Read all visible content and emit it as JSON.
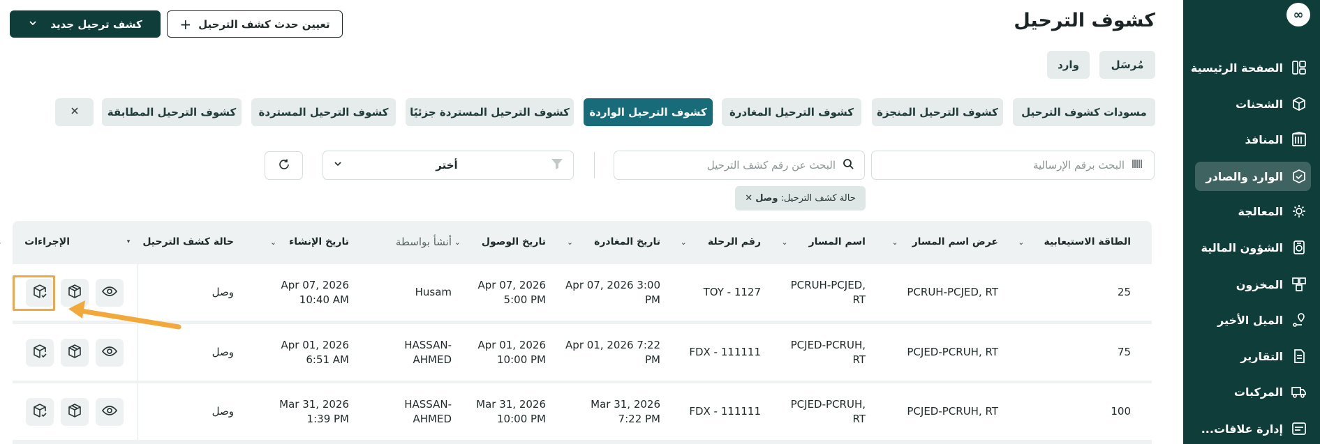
{
  "page": {
    "title": "كشوف الترحيل",
    "new_button": "كشف ترحيل جديد",
    "assign_button": "تعيين حدث كشف الترحيل"
  },
  "direction_tabs": [
    "مُرسَل",
    "وارد"
  ],
  "category_tabs": [
    "مسودات كشوف الترحيل",
    "كشوف الترحيل المنجزة",
    "كشوف الترحيل المغادرة",
    "كشوف الترحيل الواردة",
    "كشوف الترحيل المستردة جزئيًا",
    "كشوف الترحيل المستردة",
    "كشوف الترحيل المطابقة"
  ],
  "filters": {
    "consignment_search_placeholder": "البحث برقم الإرسالية",
    "manifest_search_placeholder": "البحث عن رقم كشف الترحيل",
    "select_value": "أختر",
    "active_chip_label": "حالة كشف الترحيل:",
    "active_chip_value": "وصل"
  },
  "sidebar": {
    "logo": "∞",
    "items": [
      {
        "label": "الصفحة الرئيسية",
        "icon": "home-icon"
      },
      {
        "label": "الشحنات",
        "icon": "shipments-icon"
      },
      {
        "label": "المنافذ",
        "icon": "ports-icon"
      },
      {
        "label": "الوارد والصادر",
        "icon": "inbound-outbound-icon",
        "active": true
      },
      {
        "label": "المعالجة",
        "icon": "processing-icon"
      },
      {
        "label": "الشؤون المالية",
        "icon": "finance-icon"
      },
      {
        "label": "المخزون",
        "icon": "inventory-icon"
      },
      {
        "label": "الميل الأخير",
        "icon": "last-mile-icon"
      },
      {
        "label": "التقارير",
        "icon": "reports-icon"
      },
      {
        "label": "المركبات",
        "icon": "vehicles-icon"
      },
      {
        "label": "إدارة علاقات...",
        "icon": "crm-icon"
      }
    ]
  },
  "table": {
    "columns": [
      "الطاقة الاستيعابية",
      "عرض اسم المسار",
      "اسم المسار",
      "رقم الرحلة",
      "تاريخ المغادرة",
      "تاريخ الوصول",
      "أنشأ بواسطة",
      "تاريخ الإنشاء",
      "حالة كشف الترحيل",
      "الإجراءات"
    ],
    "rows": [
      {
        "capacity": "25",
        "route_display": "PCRUH-PCJED, RT",
        "route_name_1": "PCRUH-PCJED,",
        "route_name_2": "RT",
        "trip": "TOY - 1127",
        "departure_1": "Apr 07, 2026 3:00",
        "departure_2": "PM",
        "arrival_1": "Apr 07, 2026",
        "arrival_2": "5:00 PM",
        "created_by_1": "Husam",
        "created_by_2": "",
        "created_1": "Apr 07, 2026",
        "created_2": "10:40 AM",
        "status": "وصل"
      },
      {
        "capacity": "75",
        "route_display": "PCJED-PCRUH, RT",
        "route_name_1": "PCJED-PCRUH,",
        "route_name_2": "RT",
        "trip": "FDX - 111111",
        "departure_1": "Apr 01, 2026 7:22",
        "departure_2": "PM",
        "arrival_1": "Apr 01, 2026",
        "arrival_2": "10:00 PM",
        "created_by_1": "HASSAN-",
        "created_by_2": "AHMED",
        "created_1": "Apr 01, 2026",
        "created_2": "6:51 AM",
        "status": "وصل"
      },
      {
        "capacity": "100",
        "route_display": "PCJED-PCRUH, RT",
        "route_name_1": "PCJED-PCRUH,",
        "route_name_2": "RT",
        "trip": "FDX - 111111",
        "departure_1": "Mar 31, 2026",
        "departure_2": "7:22 PM",
        "arrival_1": "Mar 31, 2026",
        "arrival_2": "10:00 PM",
        "created_by_1": "HASSAN-",
        "created_by_2": "AHMED",
        "created_1": "Mar 31, 2026",
        "created_2": "1:39 PM",
        "status": "وصل"
      }
    ]
  },
  "colors": {
    "sidebar_bg": "#0f3d3a",
    "active_tab": "#186b78",
    "highlight": "#f2a93b"
  }
}
